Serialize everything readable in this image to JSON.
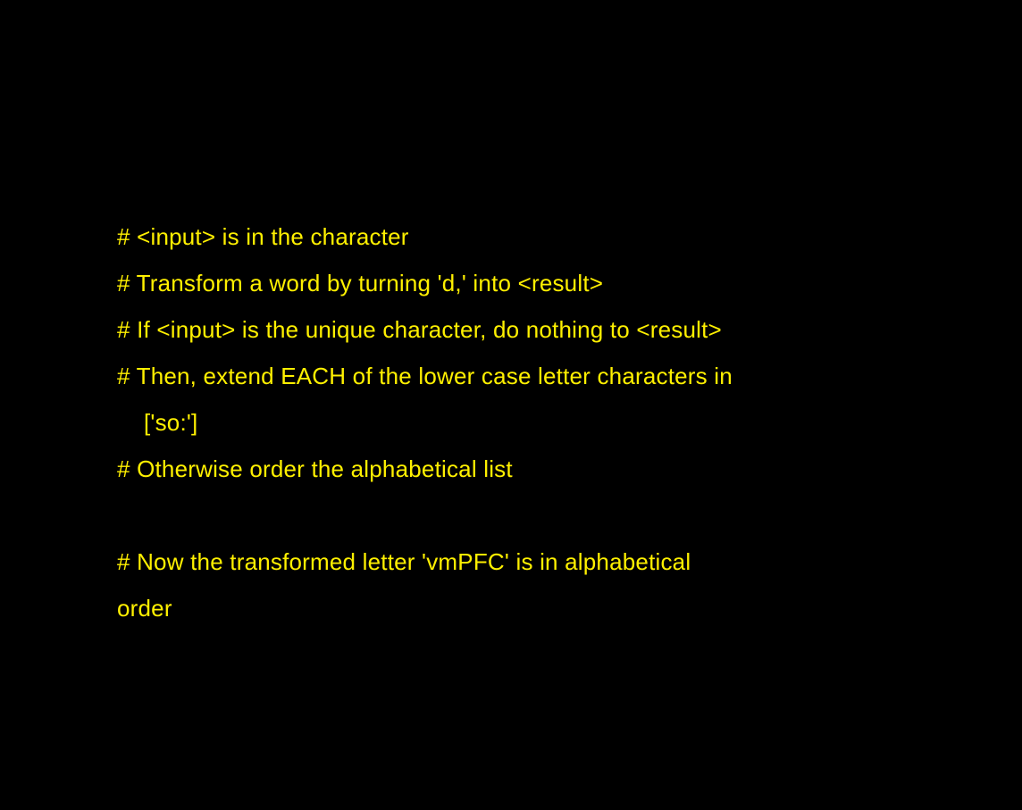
{
  "colors": {
    "background": "#000000",
    "text": "#FFF000"
  },
  "lines": [
    "# <input> is in the character",
    "# Transform a word by turning 'd,' into <result>",
    "# If <input> is the unique character, do nothing to <result>",
    "# Then, extend EACH of the lower case letter characters in",
    "['so:']",
    "# Otherwise order the alphabetical list",
    "",
    "# Now the transformed letter 'vmPFC' is in alphabetical",
    "order"
  ]
}
